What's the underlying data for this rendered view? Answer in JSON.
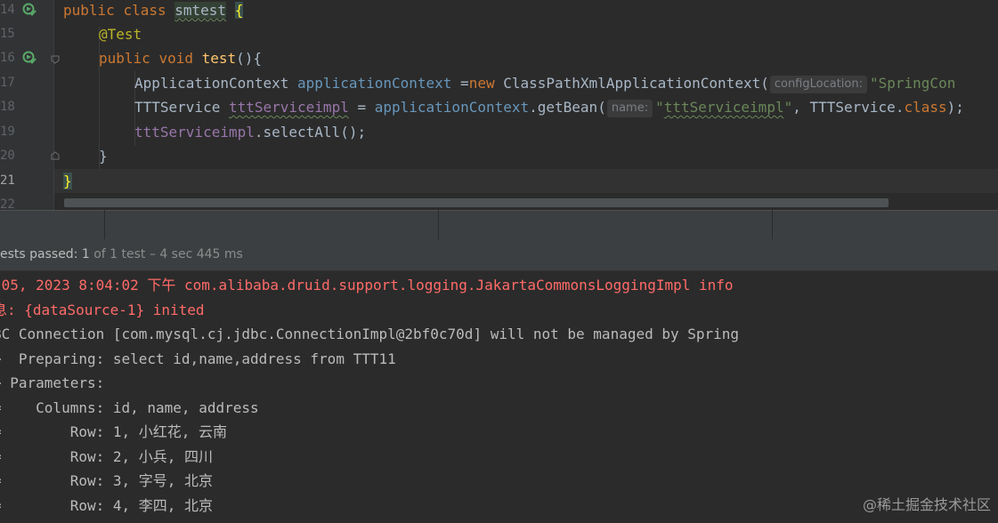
{
  "editor": {
    "line_numbers": [
      "14",
      "15",
      "16",
      "17",
      "18",
      "19",
      "20",
      "21",
      "22"
    ],
    "line14": {
      "kw1": "public",
      "kw2": "class",
      "classname": "smtest",
      "brace": "{"
    },
    "line15": {
      "annotation": "@Test"
    },
    "line16": {
      "kw1": "public",
      "kw2": "void",
      "method": "test",
      "rest": "(){"
    },
    "line17": {
      "type": "ApplicationContext",
      "var": "applicationContext",
      "op": " =",
      "kw_new": "new",
      "ctor": " ClassPathXmlApplicationContext(",
      "hint": "configLocation:",
      "str": "\"SpringCon"
    },
    "line18": {
      "type": "TTTService",
      "var": "tttServiceimpl",
      "op": " = ",
      "ref": "applicationContext",
      "call": ".getBean(",
      "hint": "name:",
      "str_q1": "\"",
      "str_body": "tttServiceimpl",
      "str_q2": "\"",
      "args": ", TTTService.",
      "kw_class": "class",
      "end": ");"
    },
    "line19": {
      "var": "tttServiceimpl",
      "call": ".selectAll();"
    },
    "line20": {
      "brace": "}"
    },
    "line21": {
      "brace": "}"
    }
  },
  "status": {
    "passed_label": "ests passed: 1",
    "detail": " of 1 test – 4 sec 445 ms"
  },
  "console": {
    "lines": [
      " 05, 2023 8:04:02 下午 com.alibaba.druid.support.logging.JakartaCommonsLoggingImpl info",
      "息: {dataSource-1} inited",
      "BC Connection [com.mysql.cj.jdbc.ConnectionImpl@2bf0c70d] will not be managed by Spring",
      ">  Preparing: select id,name,address from TTT11",
      "> Parameters: ",
      "=    Columns: id, name, address",
      "=        Row: 1, 小红花, 云南",
      "=        Row: 2, 小兵, 四川",
      "=        Row: 3, 字号, 北京",
      "=        Row: 4, 李四, 北京"
    ]
  },
  "watermark": "@稀土掘金技术社区",
  "colors": {
    "keyword": "#cc7832",
    "annotation": "#bbb529",
    "function": "#ffc66d",
    "string": "#6a8759",
    "variable": "#6897bb",
    "error": "#ff6b68",
    "background": "#2b2b2b"
  }
}
